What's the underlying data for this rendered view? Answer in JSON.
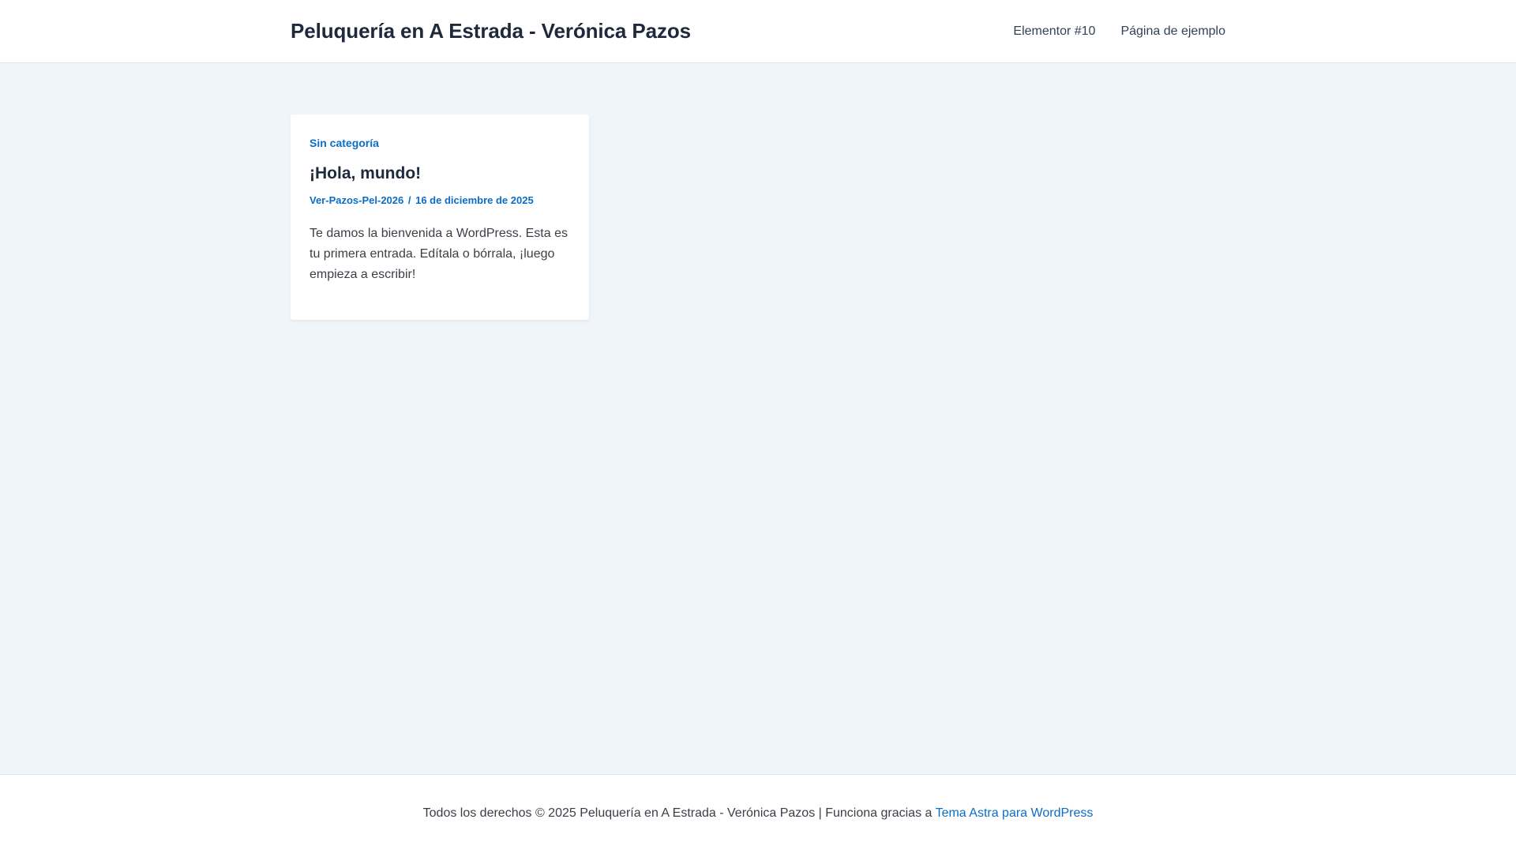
{
  "header": {
    "site_title": "Peluquería en A Estrada - Verónica Pazos",
    "nav": [
      {
        "label": "Elementor #10"
      },
      {
        "label": "Página de ejemplo"
      }
    ]
  },
  "post": {
    "category": "Sin categoría",
    "title": "¡Hola, mundo!",
    "author": "Ver-Pazos-Pel-2026",
    "separator": "/",
    "date": "16 de diciembre de 2025",
    "excerpt": "Te damos la bienvenida a WordPress. Esta es tu primera entrada. Edítala o bórrala, ¡luego empieza a escribir!"
  },
  "footer": {
    "text": "Todos los derechos © 2025 Peluquería en A Estrada - Verónica Pazos | Funciona gracias a ",
    "link_label": "Tema Astra para WordPress"
  },
  "colors": {
    "accent": "#0b6dc7",
    "background": "#f0f5fa",
    "title": "#1e293b"
  }
}
